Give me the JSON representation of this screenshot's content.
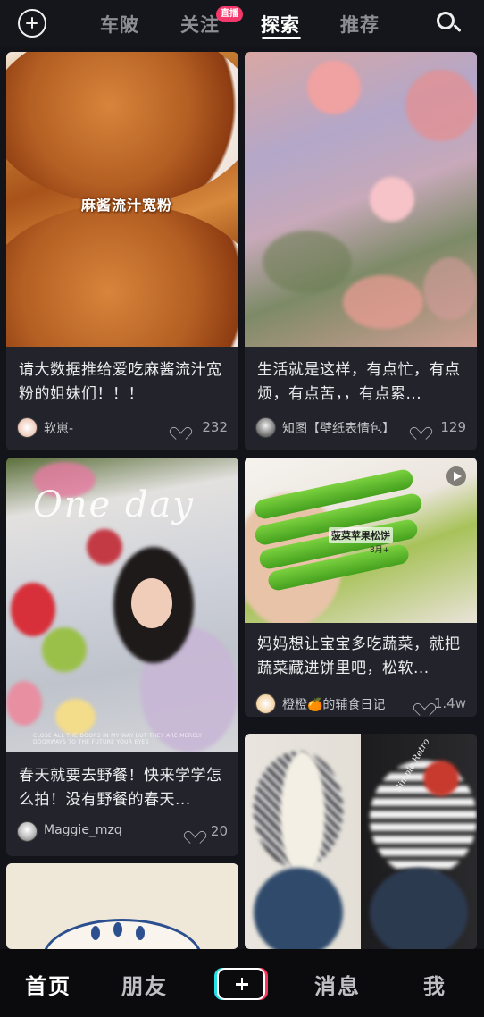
{
  "topbar": {
    "tabs": [
      "车陂",
      "关注",
      "探索",
      "推荐"
    ],
    "active_tab": "探索",
    "live_badge": "直播",
    "add_icon": "plus-circle-icon",
    "search_icon": "search-icon"
  },
  "feed": [
    {
      "overlay_text": "麻酱流汁宽粉",
      "caption": "请大数据推给爱吃麻酱流汁宽粉的姐妹们！！！",
      "author": "软崽-",
      "likes": "232"
    },
    {
      "caption": "生活就是这样，有点忙，有点烦，有点苦，，有点累...",
      "author": "知图【壁纸表情包】",
      "likes": "129"
    },
    {
      "overlay_text": "One day",
      "overlay_fine": "CLOSE ALL THE DOORS IN MY WAY BUT THEY ARE MERELY DOORWAYS TO THE FUTURE YOUR EYES",
      "caption": "春天就要去野餐！快来学学怎么拍！没有野餐的春天...",
      "author": "Maggie_mzq",
      "likes": "20"
    },
    {
      "overlay_text": "菠菜苹果松饼",
      "overlay_sub": "8月+",
      "caption": "妈妈想让宝宝多吃蔬菜，就把蔬菜藏进饼里吧，松软...",
      "author": "橙橙🍊的辅食日记",
      "likes": "1.4w",
      "is_video": true
    },
    {
      "overlay_text": "Simple Retro"
    },
    {}
  ],
  "bottombar": {
    "items": [
      "首页",
      "朋友",
      "消息",
      "我"
    ],
    "active": "首页",
    "create_icon": "plus-icon"
  },
  "colors": {
    "background": "#131419",
    "card": "#22232b",
    "live_badge": "#f4386b",
    "accent_cyan": "#24e0e4",
    "accent_red": "#f6375f"
  }
}
